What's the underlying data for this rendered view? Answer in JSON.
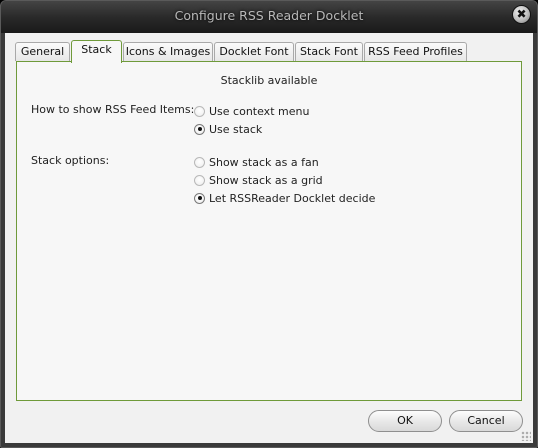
{
  "window": {
    "title": "Configure RSS Reader Docklet",
    "close_glyph": "✖"
  },
  "tabs": [
    {
      "label": "General"
    },
    {
      "label": "Stack"
    },
    {
      "label": "Icons & Images"
    },
    {
      "label": "Docklet Font"
    },
    {
      "label": "Stack Font"
    },
    {
      "label": "RSS Feed Profiles"
    }
  ],
  "active_tab": "Stack",
  "stack_tab": {
    "status": "Stacklib available",
    "show_items": {
      "label": "How to show RSS Feed Items:",
      "options": [
        {
          "label": "Use context menu",
          "checked": false
        },
        {
          "label": "Use stack",
          "checked": true
        }
      ]
    },
    "stack_options": {
      "label": "Stack options:",
      "options": [
        {
          "label": "Show stack as a fan",
          "checked": false
        },
        {
          "label": "Show stack as a grid",
          "checked": false
        },
        {
          "label": "Let RSSReader Docklet decide",
          "checked": true
        }
      ]
    }
  },
  "buttons": {
    "ok": "OK",
    "cancel": "Cancel"
  }
}
